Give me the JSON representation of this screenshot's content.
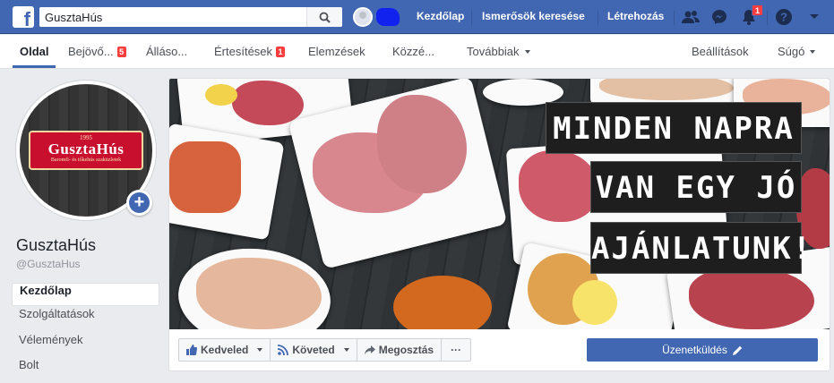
{
  "topbar": {
    "search_value": "GusztaHús",
    "links": [
      "Kezdőlap",
      "Ismerősök keresése",
      "Létrehozás"
    ],
    "notification_count": "1"
  },
  "tabs": {
    "items": [
      {
        "label": "Oldal",
        "badge": ""
      },
      {
        "label": "Bejövő...",
        "badge": "5"
      },
      {
        "label": "Álláso...",
        "badge": ""
      },
      {
        "label": "Értesítések",
        "badge": "1"
      },
      {
        "label": "Elemzések",
        "badge": ""
      },
      {
        "label": "Közzé...",
        "badge": ""
      },
      {
        "label": "Továbbiak",
        "badge": ""
      }
    ],
    "settings": "Beállítások",
    "help": "Súgó"
  },
  "profile": {
    "logo_year": "1995",
    "logo_name": "GusztaHús",
    "logo_sub": "Baromfi- és tőkehús szaküzletek",
    "name": "GusztaHús",
    "handle": "@GusztaHus"
  },
  "sidebar": {
    "items": [
      "Kezdőlap",
      "Szolgáltatások",
      "Vélemények",
      "Bolt"
    ]
  },
  "cover": {
    "lines": [
      "MINDEN NAPRA",
      "VAN EGY JÓ",
      "AJÁNLATUNK!"
    ]
  },
  "actions": {
    "like": "Kedveled",
    "follow": "Követed",
    "share": "Megosztás",
    "more": "···",
    "message": "Üzenetküldés"
  },
  "colors": {
    "brand_blue": "#4267b2",
    "badge_red": "#fa3e3e",
    "logo_red": "#c8102e"
  }
}
